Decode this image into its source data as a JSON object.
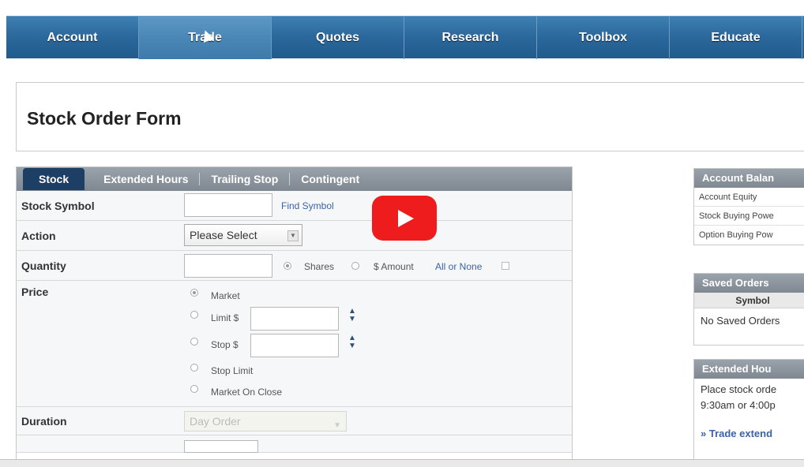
{
  "nav": {
    "items": [
      "Account",
      "Trade",
      "Quotes",
      "Research",
      "Toolbox",
      "Educate"
    ],
    "active": 1
  },
  "header": {
    "title": "Stock Order Form"
  },
  "tabs": [
    "Stock",
    "Extended Hours",
    "Trailing Stop",
    "Contingent"
  ],
  "form": {
    "symbol": {
      "label": "Stock Symbol",
      "find_link": "Find Symbol"
    },
    "action": {
      "label": "Action",
      "selected": "Please Select"
    },
    "quantity": {
      "label": "Quantity",
      "shares": "Shares",
      "amount": "$ Amount",
      "all_or_none": "All or None"
    },
    "price": {
      "label": "Price",
      "market": "Market",
      "limit": "Limit $",
      "stop": "Stop $",
      "stop_limit": "Stop Limit",
      "market_on_close": "Market On Close"
    },
    "duration": {
      "label": "Duration",
      "selected": "Day Order"
    }
  },
  "account_balance": {
    "title": "Account Balan",
    "lines": [
      "Account Equity",
      "Stock Buying Powe",
      "Option Buying Pow"
    ]
  },
  "saved_orders": {
    "title": "Saved Orders",
    "column": "Symbol",
    "empty": "No Saved Orders"
  },
  "extended_hours": {
    "title": "Extended Hou",
    "text1": "Place stock orde",
    "text2": "9:30am or 4:00p",
    "link": "» Trade extend"
  },
  "colors": {
    "nav_blue": "#2a679b",
    "tab_active": "#1d3f66",
    "link_blue": "#3a63a8",
    "play_red": "#ee1c1c"
  }
}
